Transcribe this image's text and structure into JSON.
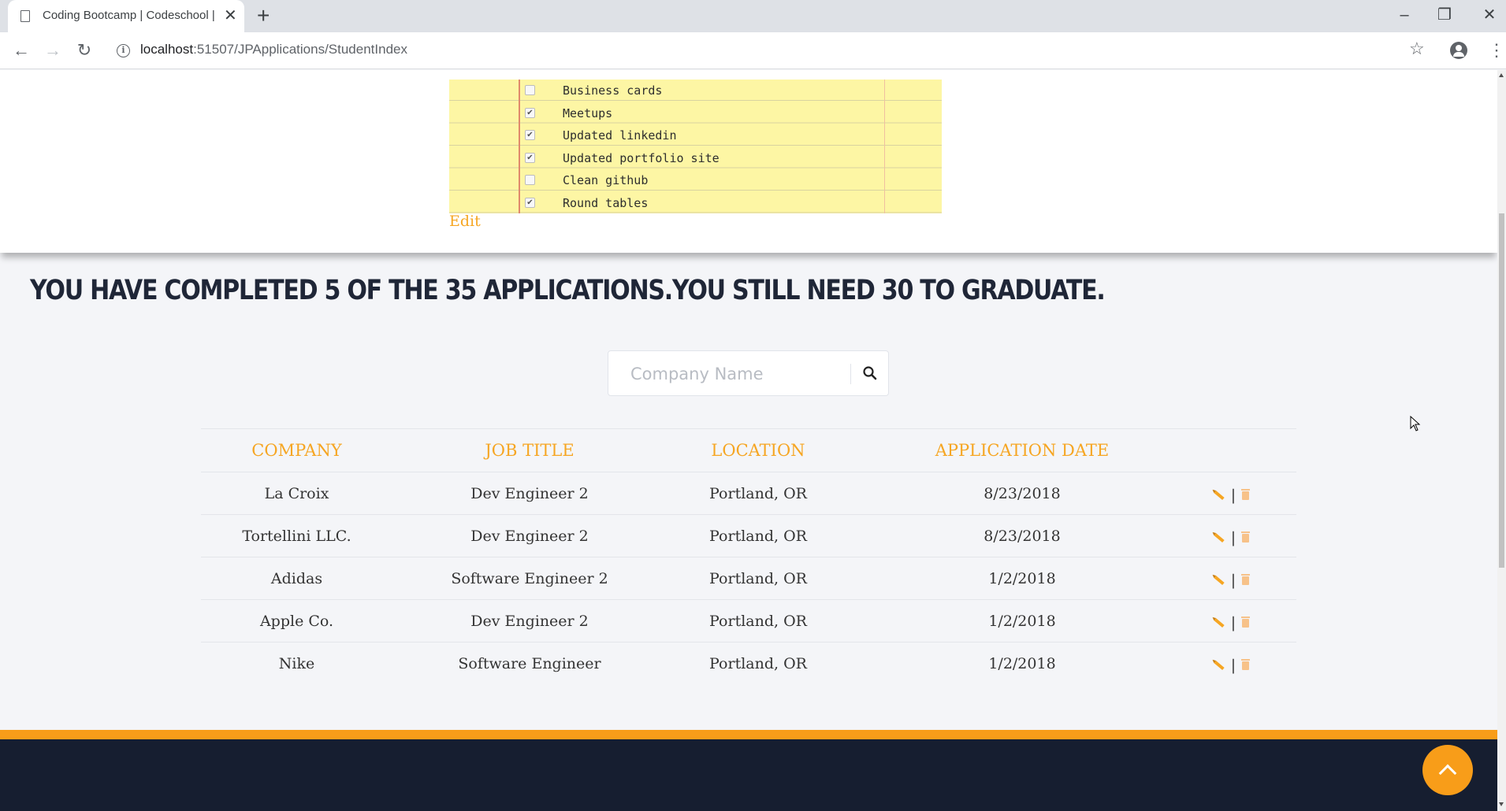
{
  "browser": {
    "tab_title": "Coding Bootcamp | Codeschool |",
    "tab_close": "✕",
    "new_tab": "+",
    "url_host": "localhost",
    "url_path": ":51507/JPApplications/StudentIndex",
    "window_minimize": "–",
    "window_restore": "❐",
    "window_close": "✕"
  },
  "checklist": {
    "items": [
      {
        "label": "Business cards",
        "checked": false
      },
      {
        "label": "Meetups",
        "checked": true
      },
      {
        "label": "Updated linkedin",
        "checked": true
      },
      {
        "label": "Updated portfolio site",
        "checked": true
      },
      {
        "label": "Clean github",
        "checked": false
      },
      {
        "label": "Round tables",
        "checked": true
      }
    ],
    "edit_label": "Edit"
  },
  "progress": {
    "headline": "YOU HAVE COMPLETED 5 OF THE 35 APPLICATIONS.YOU STILL NEED 30 TO GRADUATE.",
    "completed": 5,
    "total": 35,
    "remaining": 30
  },
  "search": {
    "placeholder": "Company Name",
    "value": ""
  },
  "table": {
    "headers": [
      "COMPANY",
      "JOB TITLE",
      "LOCATION",
      "APPLICATION DATE"
    ],
    "rows": [
      [
        "La Croix",
        "Dev Engineer 2",
        "Portland, OR",
        "8/23/2018"
      ],
      [
        "Tortellini LLC.",
        "Dev Engineer 2",
        "Portland, OR",
        "8/23/2018"
      ],
      [
        "Adidas",
        "Software Engineer 2",
        "Portland, OR",
        "1/2/2018"
      ],
      [
        "Apple Co.",
        "Dev Engineer 2",
        "Portland, OR",
        "1/2/2018"
      ],
      [
        "Nike",
        "Software Engineer",
        "Portland, OR",
        "1/2/2018"
      ]
    ],
    "action_separator": "|"
  },
  "colors": {
    "accent": "#f6a623",
    "footer_stripe": "#f89d19",
    "footer": "#161e30",
    "headline": "#1f2637",
    "notepad": "#fdf6a4"
  }
}
